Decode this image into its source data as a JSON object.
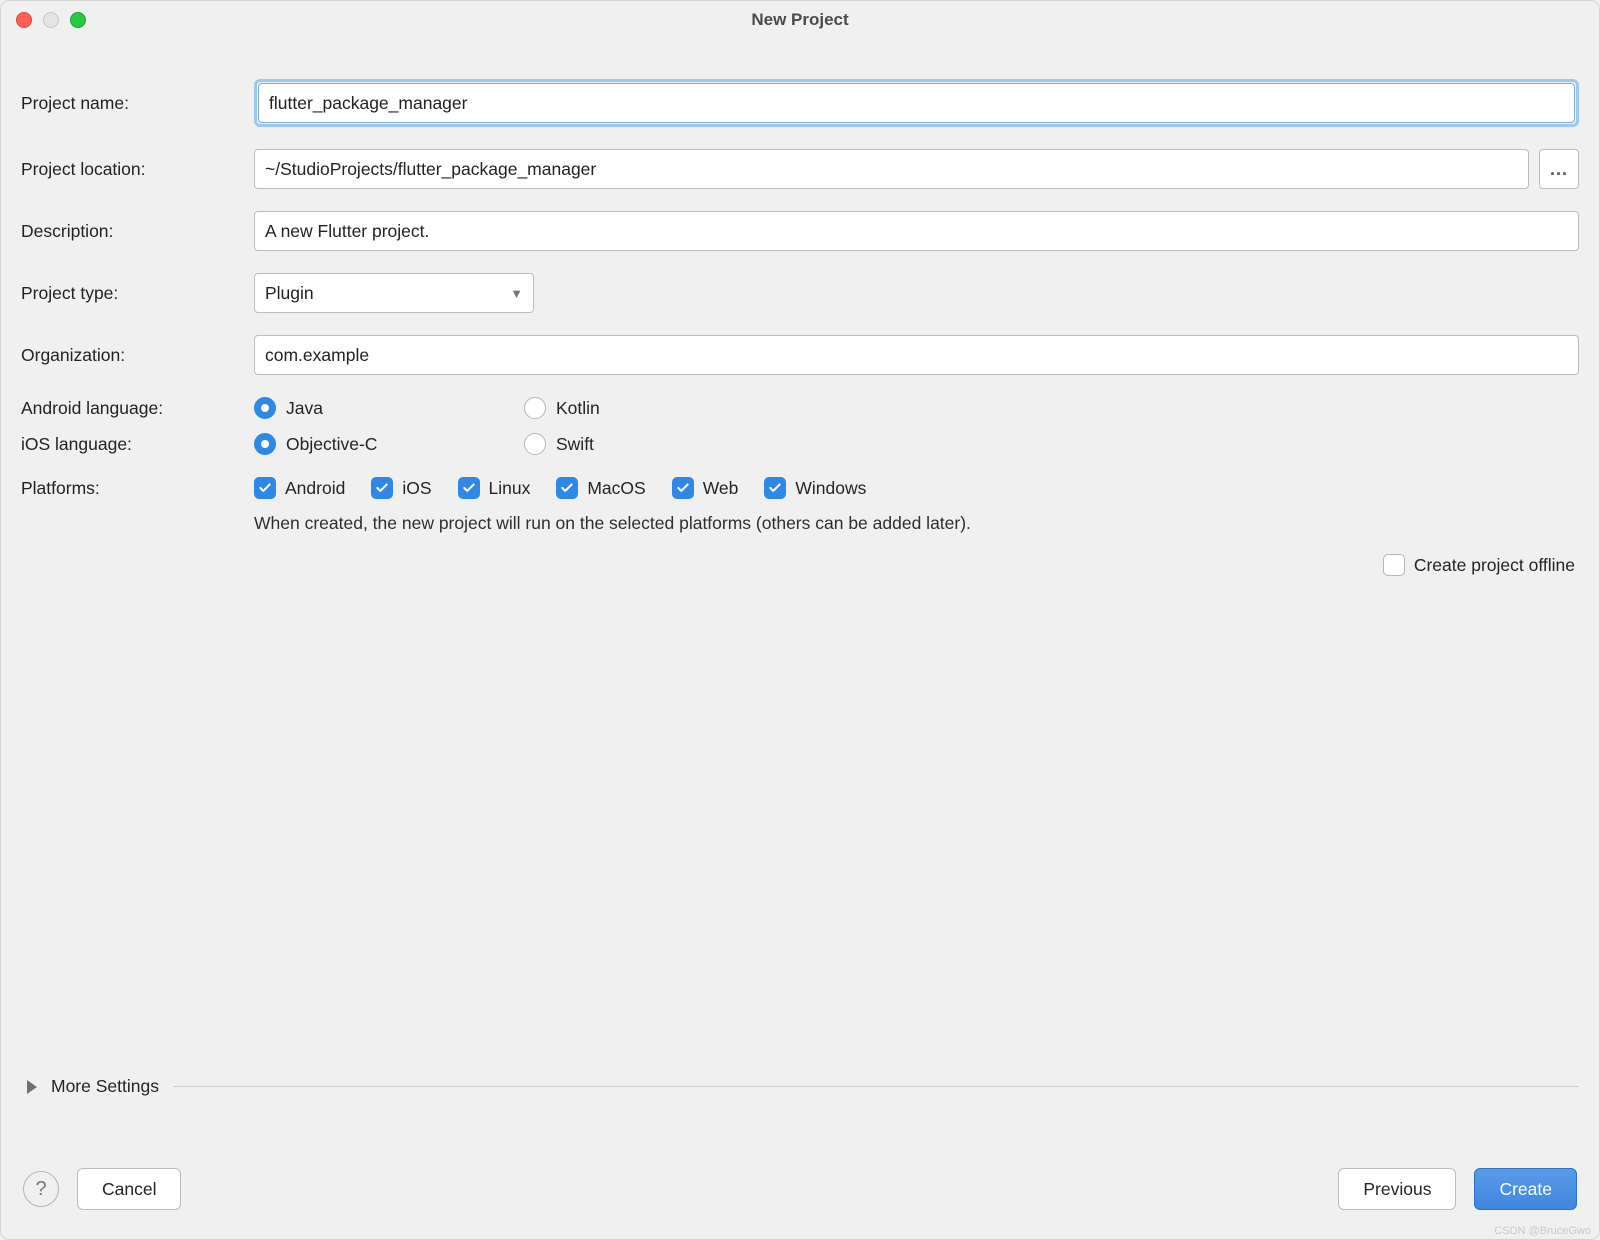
{
  "window": {
    "title": "New Project"
  },
  "labels": {
    "project_name": "Project name:",
    "project_location": "Project location:",
    "description": "Description:",
    "project_type": "Project type:",
    "organization": "Organization:",
    "android_language": "Android language:",
    "ios_language": "iOS language:",
    "platforms": "Platforms:"
  },
  "fields": {
    "project_name": "flutter_package_manager",
    "project_location": "~/StudioProjects/flutter_package_manager",
    "description": "A new Flutter project.",
    "project_type": "Plugin",
    "organization": "com.example"
  },
  "browse_label": "...",
  "android_language": {
    "options": [
      "Java",
      "Kotlin"
    ],
    "selected": "Java"
  },
  "ios_language": {
    "options": [
      "Objective-C",
      "Swift"
    ],
    "selected": "Objective-C"
  },
  "platforms": {
    "items": [
      {
        "label": "Android",
        "checked": true
      },
      {
        "label": "iOS",
        "checked": true
      },
      {
        "label": "Linux",
        "checked": true
      },
      {
        "label": "MacOS",
        "checked": true
      },
      {
        "label": "Web",
        "checked": true
      },
      {
        "label": "Windows",
        "checked": true
      }
    ],
    "hint": "When created, the new project will run on the selected platforms (others can be added later)."
  },
  "offline": {
    "label": "Create project offline",
    "checked": false
  },
  "more_settings_label": "More Settings",
  "footer": {
    "cancel": "Cancel",
    "previous": "Previous",
    "create": "Create"
  },
  "watermark": "CSDN @BruceGwo"
}
